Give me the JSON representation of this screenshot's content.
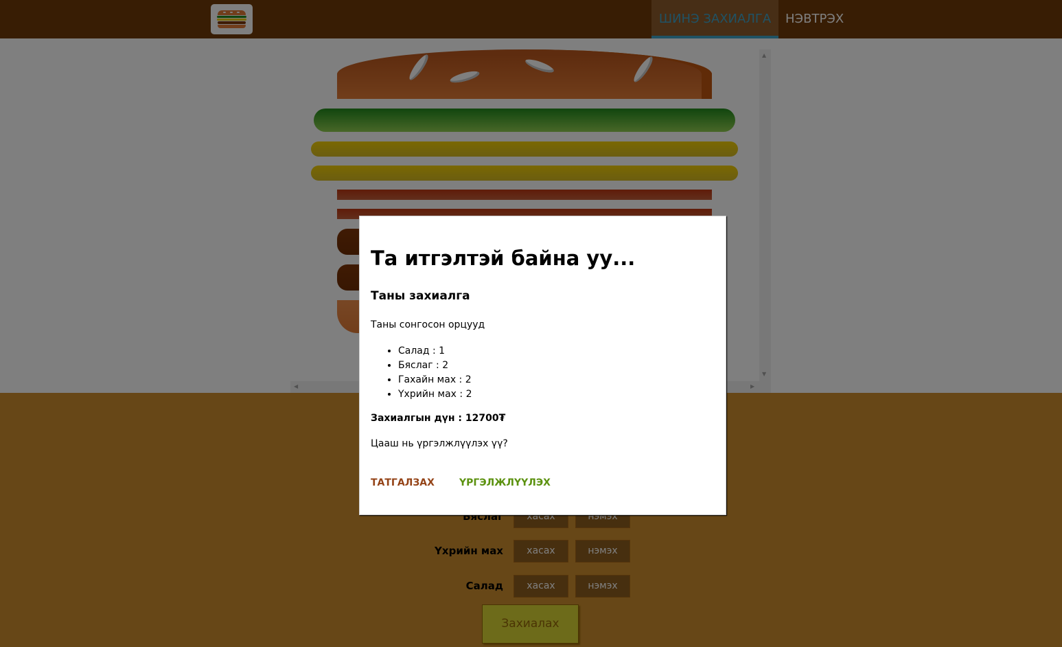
{
  "header": {
    "logo_icon": "burger-logo-icon",
    "nav": [
      {
        "label": "ШИНЭ ЗАХИАЛГА",
        "active": true
      },
      {
        "label": "НЭВТРЭХ",
        "active": false
      }
    ],
    "colors": {
      "background": "#703b09",
      "active": "#40a4c8"
    }
  },
  "burger": {
    "layers": [
      "bread-top",
      "salad",
      "cheese",
      "cheese",
      "bacon",
      "bacon",
      "meat",
      "meat",
      "bread-bottom"
    ]
  },
  "controls": {
    "rows": [
      {
        "label": "Бяслаг",
        "less": "хасах",
        "more": "нэмэх"
      },
      {
        "label": "Үхрийн мах",
        "less": "хасах",
        "more": "нэмэх"
      },
      {
        "label": "Салад",
        "less": "хасах",
        "more": "нэмэх"
      }
    ],
    "order_button": "Захиалах"
  },
  "modal": {
    "title": "Та итгэлтэй байна уу...",
    "subtitle": "Таны захиалга",
    "intro": "Таны сонгосон орцууд",
    "ingredients": [
      "Салад : 1",
      "Бяслаг : 2",
      "Гахайн мах : 2",
      "Үхрийн мах : 2"
    ],
    "total": "Захиалгын дүн : 12700₮",
    "question": "Цааш нь үргэлжлүүлэх үү?",
    "cancel_button": "ТАТГАЛЗАХ",
    "continue_button": "ҮРГЭЛЖЛҮҮЛЭХ",
    "colors": {
      "cancel": "#944317",
      "continue": "#5c9210"
    }
  }
}
